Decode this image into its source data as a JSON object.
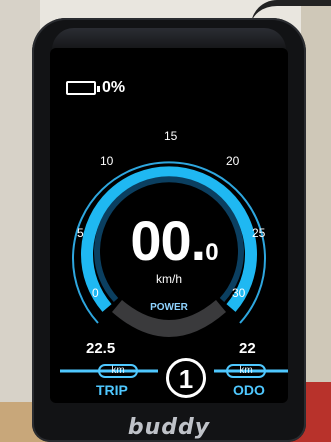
{
  "status": {
    "battery_percent": "0%",
    "battery_level": 0
  },
  "display": {
    "speed_main": "00.",
    "speed_decimal": "0",
    "speed_unit": "km/h",
    "power_label": "POWER",
    "gauge_ticks": [
      "0",
      "5",
      "10",
      "15",
      "20",
      "25",
      "30"
    ]
  },
  "trip": {
    "value": "22.5",
    "unit": "km",
    "label": "TRIP"
  },
  "assist": {
    "level": "1"
  },
  "odo": {
    "value": "22",
    "unit": "km",
    "label": "ODO"
  },
  "brand": {
    "logo_text": "buddy"
  },
  "colors": {
    "accent": "#4fc8ff",
    "screen_bg": "#000000",
    "device_body": "#121315"
  }
}
